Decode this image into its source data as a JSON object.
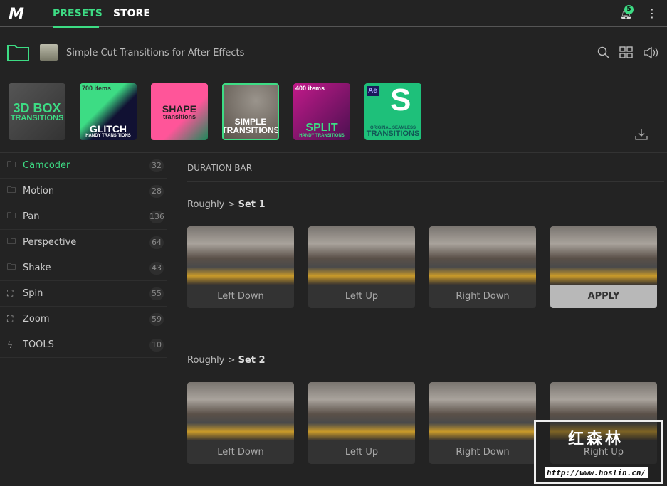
{
  "nav": {
    "logo": "M",
    "tabs": [
      "PRESETS",
      "STORE"
    ],
    "notifications": "5"
  },
  "header": {
    "title": "Simple Cut Transitions for After Effects"
  },
  "packs": [
    {
      "line1": "3D BOX",
      "line2": "TRANSITIONS"
    },
    {
      "line1": "GLITCH",
      "line2": "HANDY TRANSITIONS",
      "count": "700 items"
    },
    {
      "line1": "SHAPE",
      "line2": "transitions"
    },
    {
      "line1": "SIMPLE",
      "line2": "TRANSITIONS"
    },
    {
      "line1": "SPLIT",
      "line2": "HANDY TRANSITIONS",
      "count": "400 items"
    },
    {
      "line1": "ORIGINAL SEAMLESS",
      "line2": "TRANSITIONS",
      "badge": "Ae"
    }
  ],
  "sidebar": [
    {
      "label": "Camcoder",
      "count": "32"
    },
    {
      "label": "Motion",
      "count": "28"
    },
    {
      "label": "Pan",
      "count": "136"
    },
    {
      "label": "Perspective",
      "count": "64"
    },
    {
      "label": "Shake",
      "count": "43"
    },
    {
      "label": "Spin",
      "count": "55"
    },
    {
      "label": "Zoom",
      "count": "59"
    },
    {
      "label": "TOOLS",
      "count": "10"
    }
  ],
  "main": {
    "section": "DURATION BAR",
    "set1": {
      "prefix": "Roughly >",
      "name": "Set 1",
      "cards": [
        "Left Down",
        "Left Up",
        "Right Down",
        "APPLY"
      ]
    },
    "set2": {
      "prefix": "Roughly >",
      "name": "Set 2",
      "cards": [
        "Left Down",
        "Left Up",
        "Right Down",
        "Right Up"
      ]
    }
  },
  "watermark": {
    "title": "红森林",
    "url": "http://www.hoslin.cn/"
  }
}
